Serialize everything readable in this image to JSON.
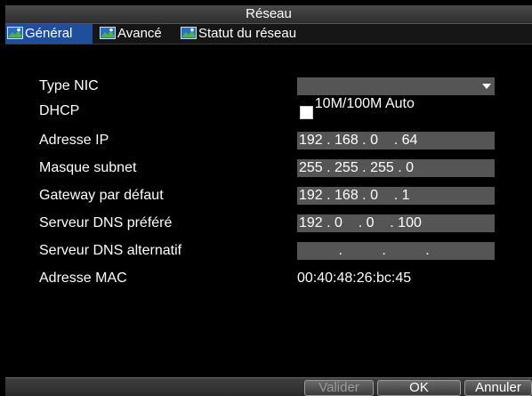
{
  "window": {
    "title": "Réseau"
  },
  "tabs": [
    {
      "label": "Général",
      "icon": "network-icon",
      "active": true
    },
    {
      "label": "Avancé",
      "icon": "network-icon",
      "active": false
    },
    {
      "label": "Statut du réseau",
      "icon": "network-icon",
      "active": false
    }
  ],
  "form": {
    "nic_type": {
      "label": "Type NIC",
      "value": "10M/100M Auto"
    },
    "dhcp": {
      "label": "DHCP",
      "checked": false
    },
    "ip_address": {
      "label": "Adresse IP",
      "value": "192 . 168 . 0    . 64"
    },
    "subnet_mask": {
      "label": "Masque subnet",
      "value": "255 . 255 . 255 . 0"
    },
    "gateway": {
      "label": "Gateway par défaut",
      "value": "192 . 168 . 0    . 1"
    },
    "dns_preferred": {
      "label": "Serveur DNS préféré",
      "value": "192 . 0    . 0    . 100"
    },
    "dns_alternate": {
      "label": "Serveur DNS alternatif",
      "value": "          .          .          ."
    },
    "mac_address": {
      "label": "Adresse MAC",
      "value": "00:40:48:26:bc:45"
    }
  },
  "buttons": {
    "apply": "Valider",
    "ok": "OK",
    "cancel": "Annuler"
  },
  "colors": {
    "active_tab": "#1f4f9c",
    "field_bg": "#555555",
    "background": "#000000"
  }
}
